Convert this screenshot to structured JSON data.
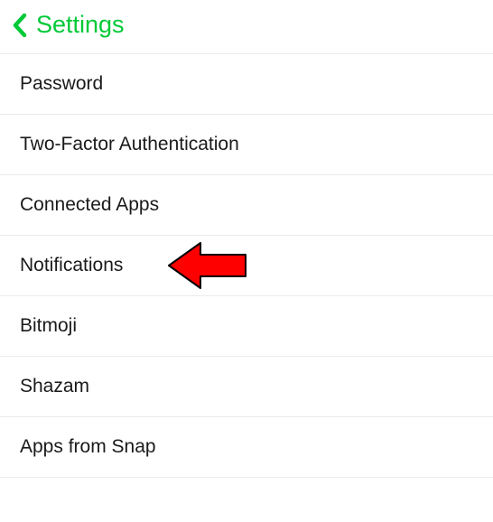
{
  "header": {
    "title": "Settings"
  },
  "items": [
    {
      "label": "Password",
      "highlighted": false
    },
    {
      "label": "Two-Factor Authentication",
      "highlighted": false
    },
    {
      "label": "Connected Apps",
      "highlighted": false
    },
    {
      "label": "Notifications",
      "highlighted": true
    },
    {
      "label": "Bitmoji",
      "highlighted": false
    },
    {
      "label": "Shazam",
      "highlighted": false
    },
    {
      "label": "Apps from Snap",
      "highlighted": false
    }
  ],
  "colors": {
    "accent": "#00c938",
    "arrow": "#ff0000"
  }
}
